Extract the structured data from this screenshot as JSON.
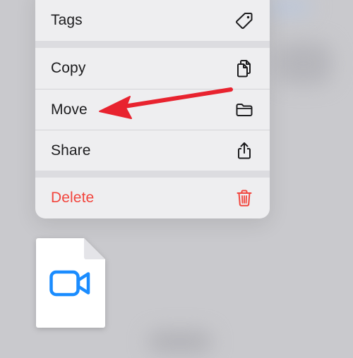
{
  "menu": {
    "items": [
      {
        "label": "Tags",
        "icon": "tag-icon"
      },
      {
        "label": "Copy",
        "icon": "copy-icon"
      },
      {
        "label": "Move",
        "icon": "folder-icon"
      },
      {
        "label": "Share",
        "icon": "share-icon"
      },
      {
        "label": "Delete",
        "icon": "trash-icon"
      }
    ]
  },
  "file": {
    "icon": "video-camera-icon"
  },
  "annotation": {
    "icon": "red-arrow-icon",
    "target": "Move"
  },
  "colors": {
    "destructive": "#f2453d",
    "accent": "#1a8cff",
    "arrow": "#e8232f",
    "menu_bg": "#eeeef0",
    "page_bg": "#c9c9cd"
  }
}
